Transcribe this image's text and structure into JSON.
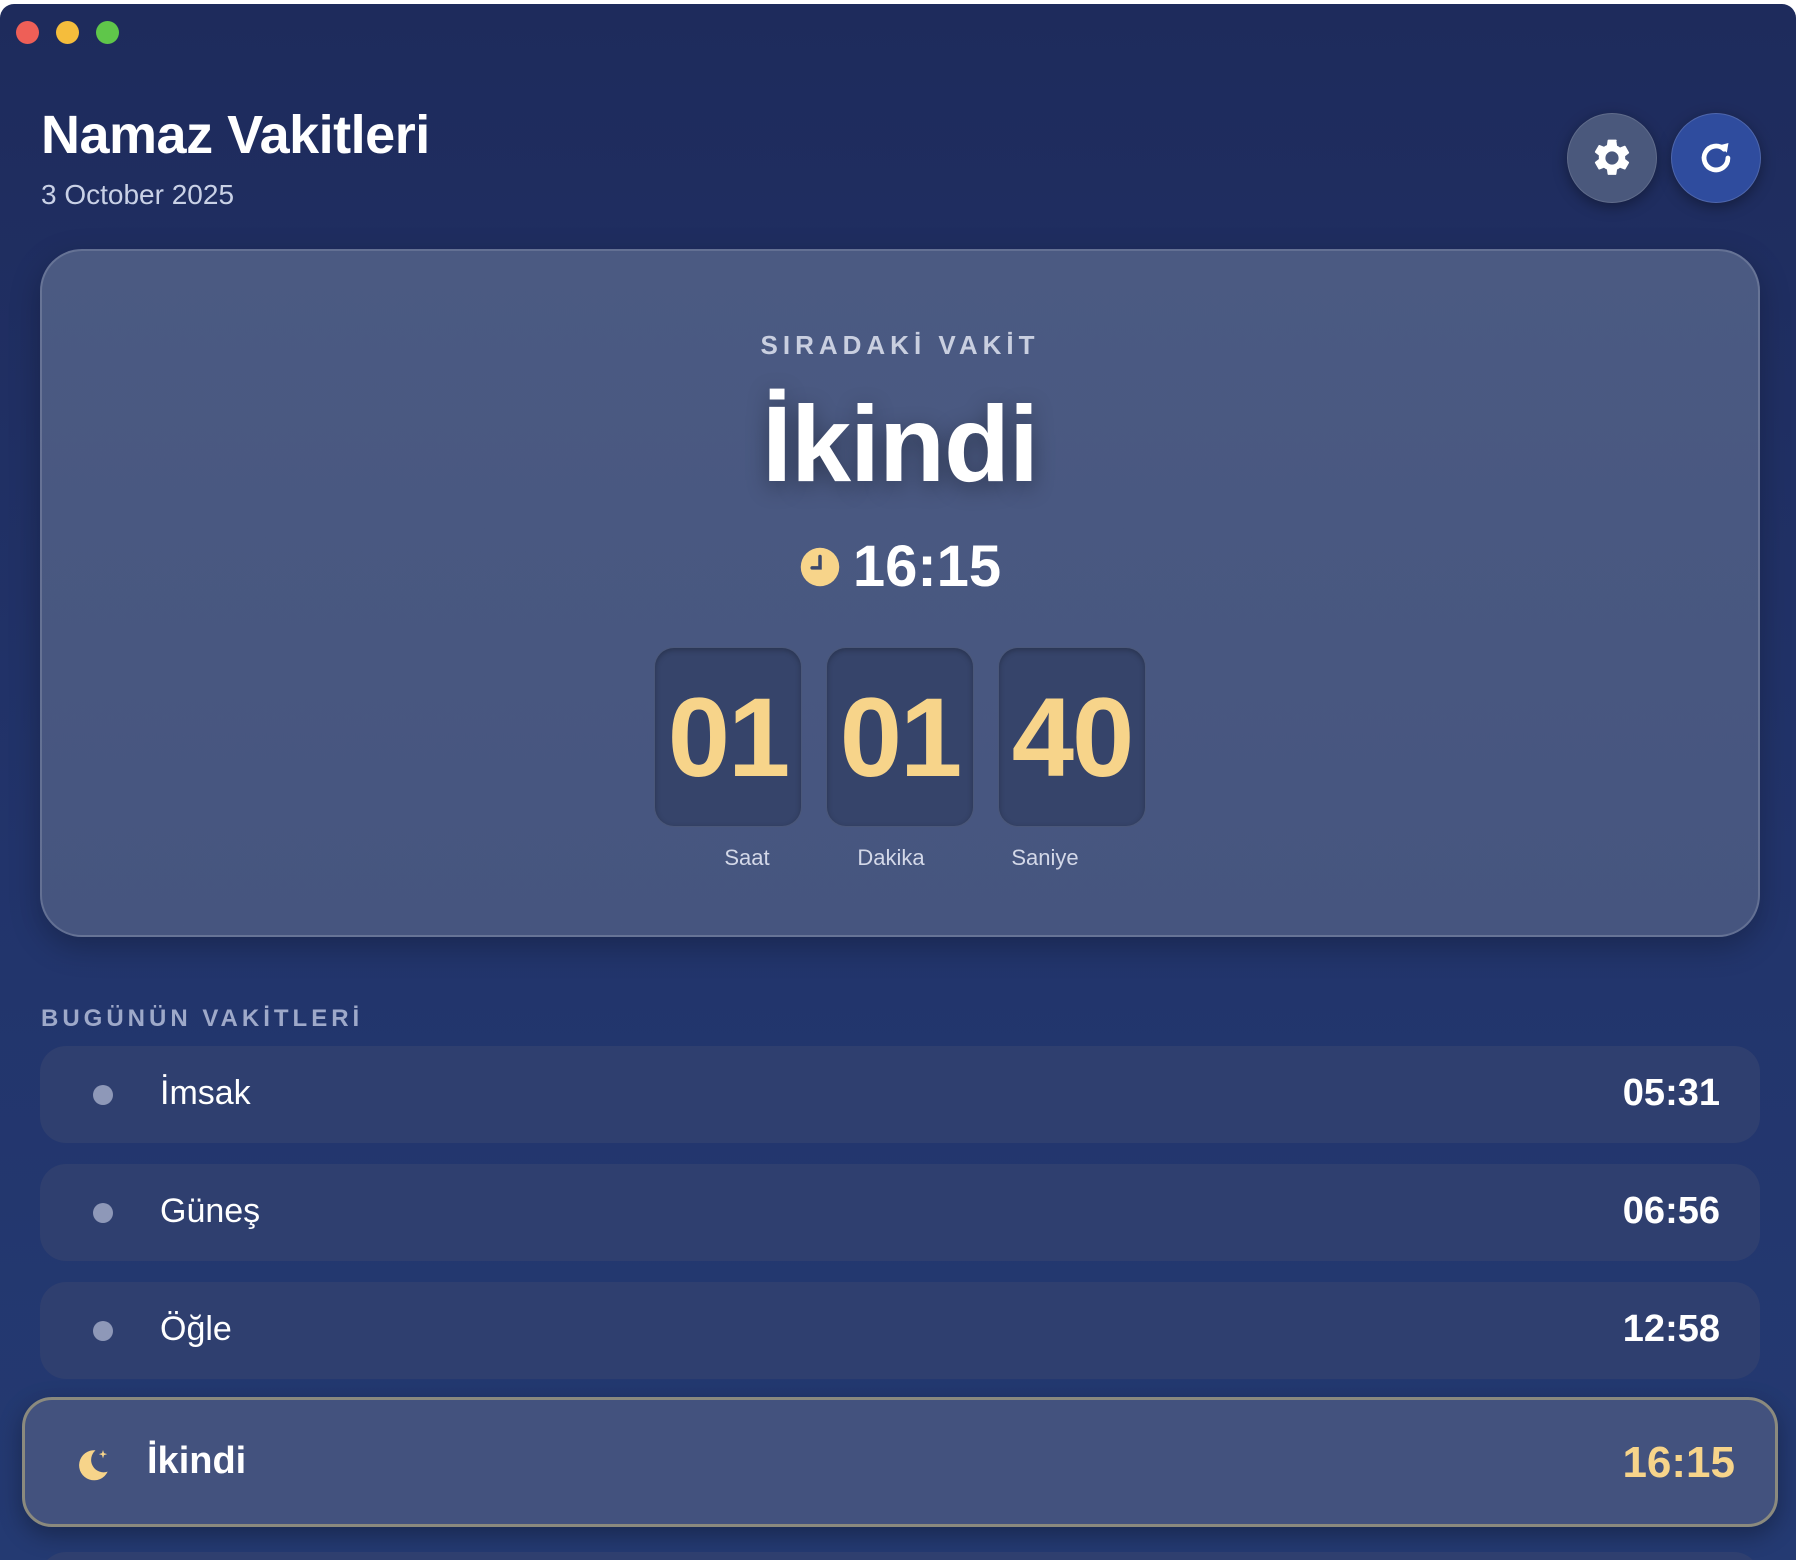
{
  "header": {
    "title": "Namaz Vakitleri",
    "date": "3 October 2025",
    "settings_icon": "gear-icon",
    "refresh_icon": "refresh-icon"
  },
  "next_prayer": {
    "label": "SIRADAKİ VAKİT",
    "name": "İkindi",
    "time": "16:15",
    "countdown": {
      "hours": "01",
      "minutes": "01",
      "seconds": "40",
      "hours_label": "Saat",
      "minutes_label": "Dakika",
      "seconds_label": "Saniye"
    }
  },
  "today": {
    "title": "BUGÜNÜN VAKİTLERİ",
    "prayers": [
      {
        "name": "İmsak",
        "time": "05:31"
      },
      {
        "name": "Güneş",
        "time": "06:56"
      },
      {
        "name": "Öğle",
        "time": "12:58"
      },
      {
        "name": "İkindi",
        "time": "16:15",
        "active": true
      }
    ]
  },
  "colors": {
    "accent": "#f7d48a",
    "background": "#1e2b5c",
    "card": "#46557f"
  }
}
